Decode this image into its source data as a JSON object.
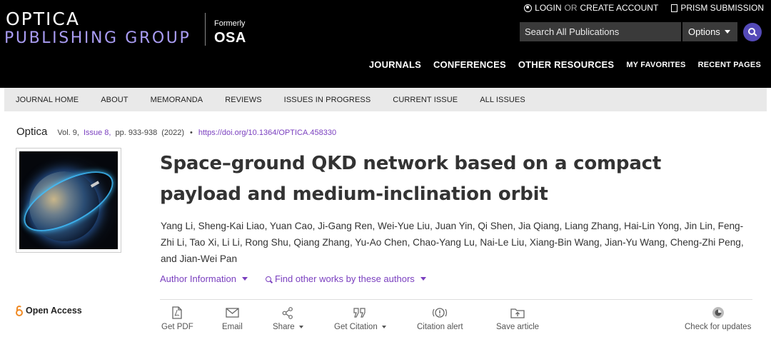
{
  "header": {
    "logo_line1": "OPTICA",
    "logo_line2": "PUBLISHING GROUP",
    "formerly": "Formerly",
    "formerly_name": "OSA",
    "login": "LOGIN",
    "or": "OR",
    "create_account": "CREATE ACCOUNT",
    "prism": "PRISM SUBMISSION",
    "search_placeholder": "Search All Publications",
    "options": "Options",
    "nav": [
      "JOURNALS",
      "CONFERENCES",
      "OTHER RESOURCES",
      "MY FAVORITES",
      "RECENT PAGES"
    ]
  },
  "journal_nav": [
    "JOURNAL HOME",
    "ABOUT",
    "MEMORANDA",
    "REVIEWS",
    "ISSUES IN PROGRESS",
    "CURRENT ISSUE",
    "ALL ISSUES"
  ],
  "citation": {
    "journal": "Optica",
    "volume": "Vol. 9,",
    "issue": "Issue 8,",
    "pages": "pp. 933-938",
    "year": "(2022)",
    "bullet": "•",
    "doi": "https://doi.org/10.1364/OPTICA.458330"
  },
  "article": {
    "title": "Space–ground QKD network based on a compact payload and medium-inclination orbit",
    "authors": "Yang Li, Sheng-Kai Liao, Yuan Cao, Ji-Gang Ren, Wei-Yue Liu, Juan Yin, Qi Shen, Jia Qiang, Liang Zhang, Hai-Lin Yong, Jin Lin, Feng-Zhi Li, Tao Xi, Li Li, Rong Shu, Qiang Zhang, Yu-Ao Chen, Chao-Yang Lu, Nai-Le Liu, Xiang-Bin Wang, Jian-Yu Wang, Cheng-Zhi Peng, and Jian-Wei Pan",
    "author_info": "Author Information",
    "find_works": "Find other works by these authors"
  },
  "open_access": "Open Access",
  "toolbar": {
    "get_pdf": "Get PDF",
    "email": "Email",
    "share": "Share",
    "get_citation": "Get Citation",
    "citation_alert": "Citation alert",
    "save_article": "Save article",
    "check_updates": "Check for updates"
  },
  "colors": {
    "brand_purple": "#a99cf3",
    "link_purple": "#7a3fbf",
    "search_button": "#544ab8",
    "open_access_orange": "#f08a24"
  }
}
